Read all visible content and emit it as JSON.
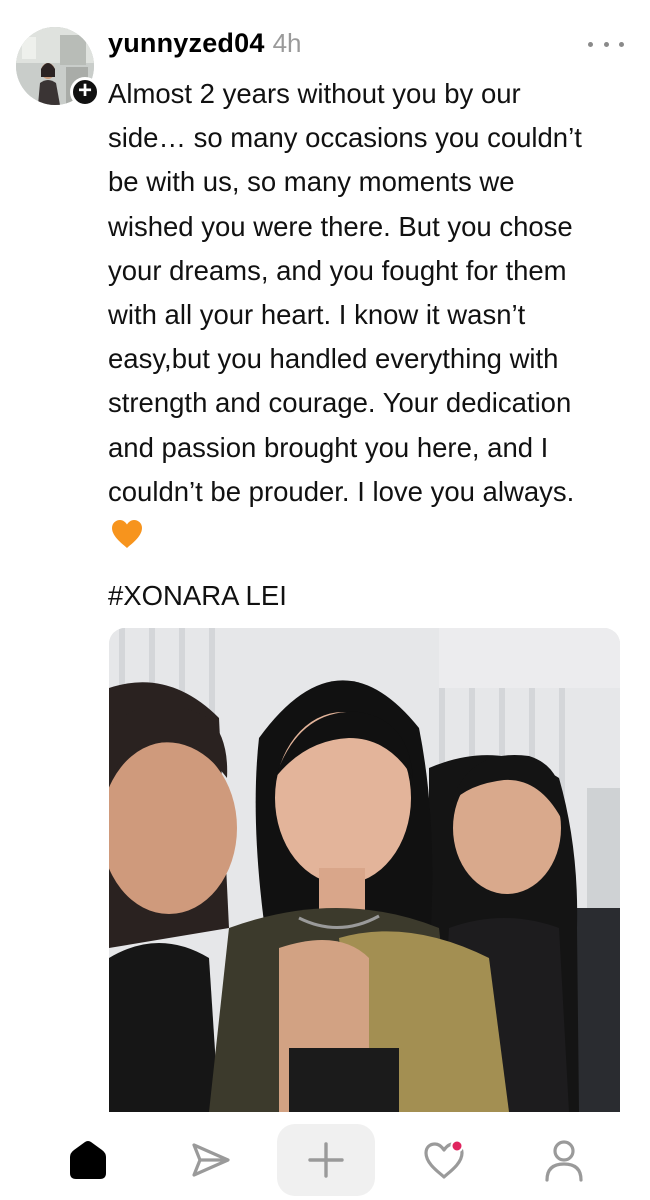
{
  "post": {
    "username": "yunnyzed04",
    "timestamp": "4h",
    "follow_glyph": "+",
    "more_icon": "more-horizontal-icon",
    "body": "Almost 2 years without you by our\nside… so many occasions you couldn’t\nbe with us, so many moments we\nwished you were there. But you chose\nyour dreams, and you fought for them\nwith all your heart. I know it wasn’t\neasy,but you handled everything with\nstrength and courage. Your dedication\nand passion brought you here, and I\ncouldn’t be prouder. I love you always.",
    "emoji": "orange-heart",
    "hashtag": "#XONARA LEI"
  },
  "nav": {
    "items": [
      "home-icon",
      "send-icon",
      "create-icon",
      "activity-icon",
      "profile-icon"
    ],
    "create_glyph": "+",
    "notification_color": "#e0245e"
  },
  "colors": {
    "text": "#111111",
    "muted": "#9a9a9a",
    "heart": "#f7941d"
  }
}
